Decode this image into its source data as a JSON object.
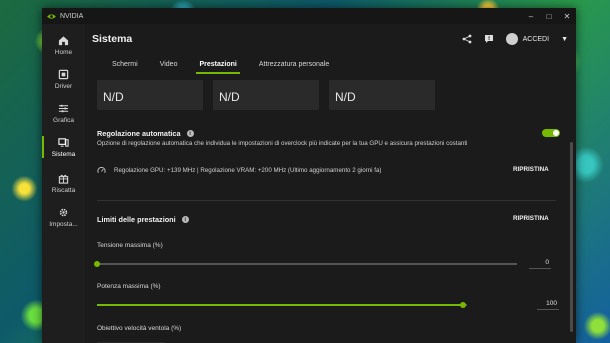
{
  "app": {
    "name": "NVIDIA",
    "accent": "#76b900"
  },
  "sidebar": {
    "items": [
      {
        "label": "Home",
        "icon": "home-icon"
      },
      {
        "label": "Driver",
        "icon": "driver-icon"
      },
      {
        "label": "Grafica",
        "icon": "sliders-icon"
      },
      {
        "label": "Sistema",
        "icon": "monitor-icon",
        "active": true
      },
      {
        "label": "Riscatta",
        "icon": "gift-icon"
      },
      {
        "label": "Imposta...",
        "icon": "gear-icon"
      }
    ]
  },
  "header": {
    "title": "Sistema",
    "user_label": "ACCEDI"
  },
  "tabs": [
    "Schermi",
    "Video",
    "Prestazioni",
    "Attrezzatura personale"
  ],
  "active_tab": "Prestazioni",
  "cards": [
    "N/D",
    "N/D",
    "N/D"
  ],
  "auto_tuning": {
    "title": "Regolazione automatica",
    "description": "Opzione di regolazione automatica che individua le impostazioni di overclock più indicate per la tua GPU e assicura prestazioni costanti",
    "enabled": true,
    "status": "Regolazione GPU: +139 MHz  |  Regolazione VRAM: +200 MHz (Ultimo aggiornamento 2 giorni fa)",
    "reset_label": "RIPRISTINA"
  },
  "limits": {
    "title": "Limiti delle prestazioni",
    "reset_label": "RIPRISTINA",
    "voltage": {
      "label": "Tensione massima (%)",
      "value": "0",
      "fraction": 0.0
    },
    "power": {
      "label": "Potenza massima (%)",
      "value": "100",
      "fraction": 0.99
    },
    "fan": {
      "label": "Obiettivo velocità ventola (%)"
    }
  }
}
